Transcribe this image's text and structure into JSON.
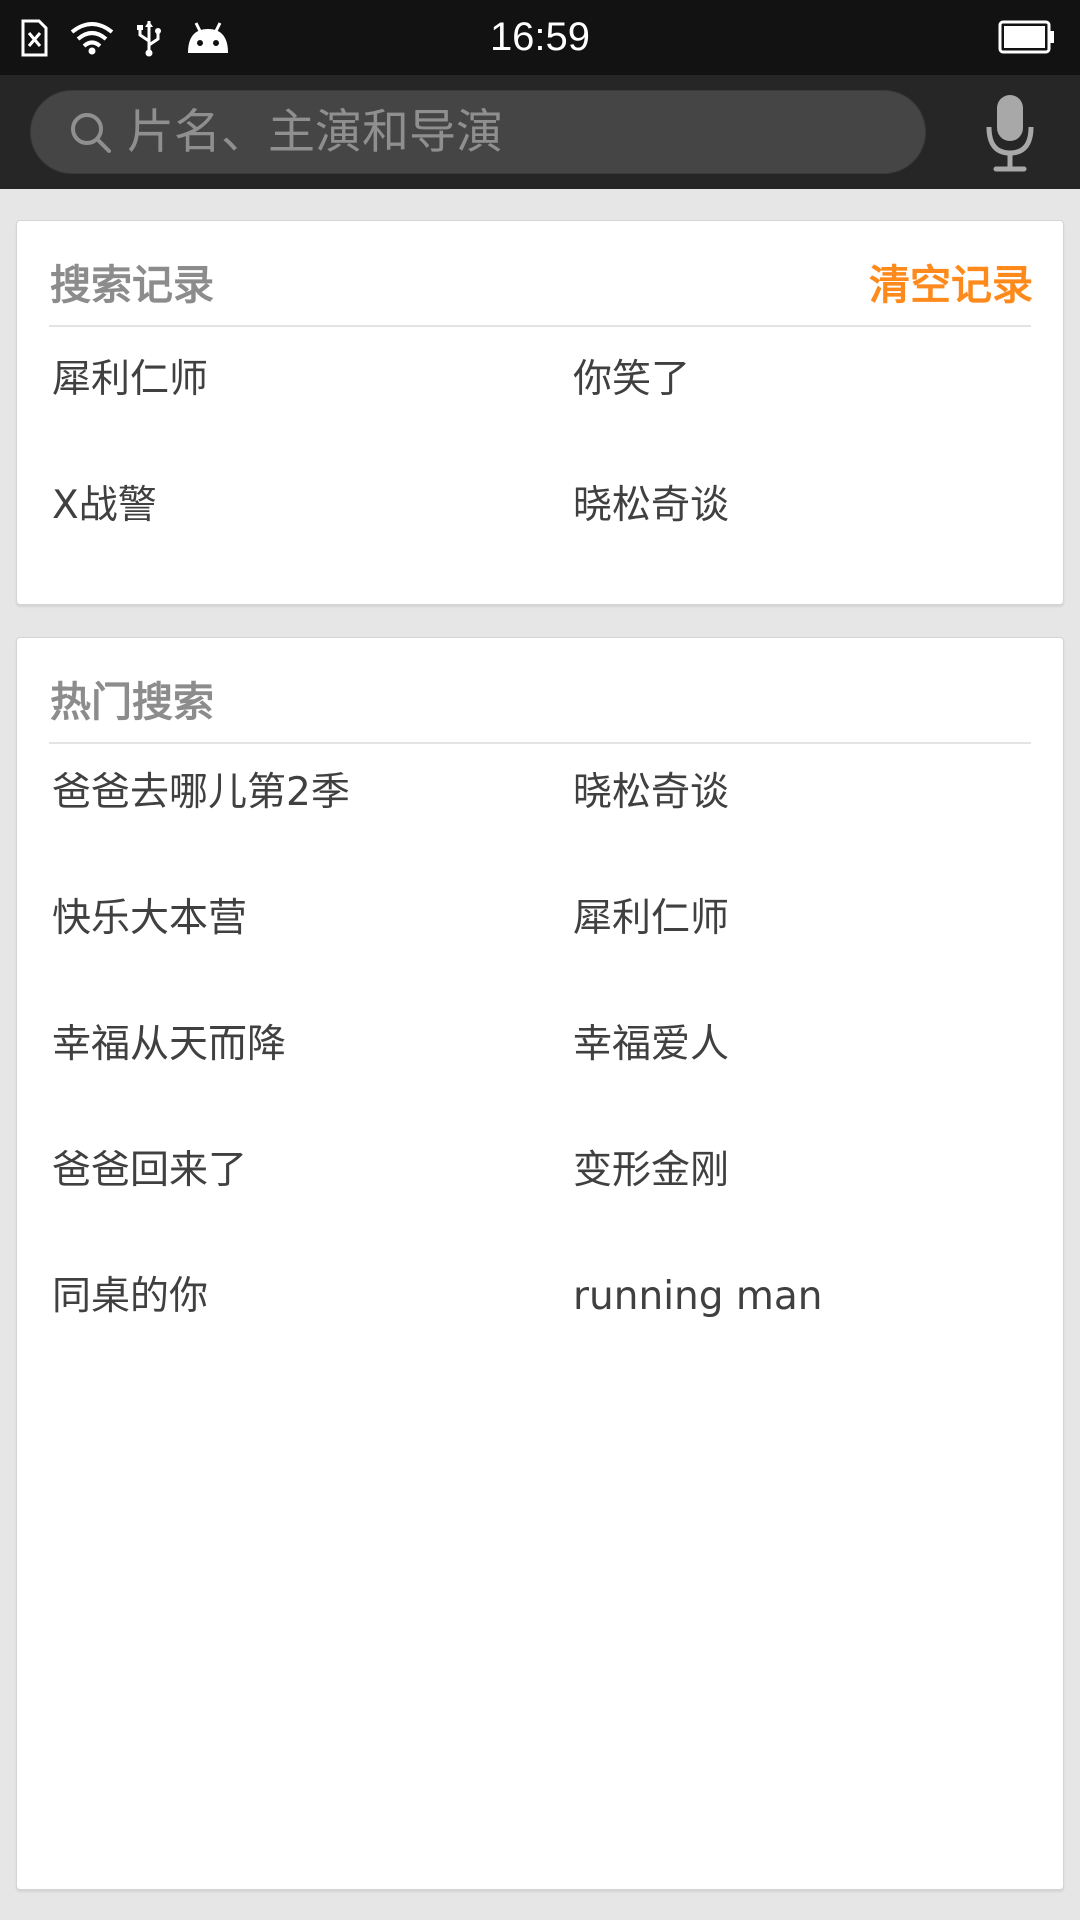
{
  "status_bar": {
    "time": "16:59",
    "icons": [
      "sim-error-icon",
      "wifi-icon",
      "usb-icon",
      "android-icon",
      "battery-icon"
    ]
  },
  "search": {
    "placeholder": "片名、主演和导演"
  },
  "history": {
    "title": "搜索记录",
    "clear_label": "清空记录",
    "items": [
      "犀利仁师",
      "你笑了",
      "X战警",
      "晓松奇谈"
    ]
  },
  "hot": {
    "title": "热门搜索",
    "items": [
      "爸爸去哪儿第2季",
      "晓松奇谈",
      "快乐大本营",
      "犀利仁师",
      "幸福从天而降",
      "幸福爱人",
      "爸爸回来了",
      "变形金刚",
      "同桌的你",
      "running man"
    ]
  },
  "colors": {
    "accent": "#ff8a1c",
    "status_bar_bg": "#121212",
    "header_bg": "#262626",
    "page_bg": "#e6e6e6"
  }
}
